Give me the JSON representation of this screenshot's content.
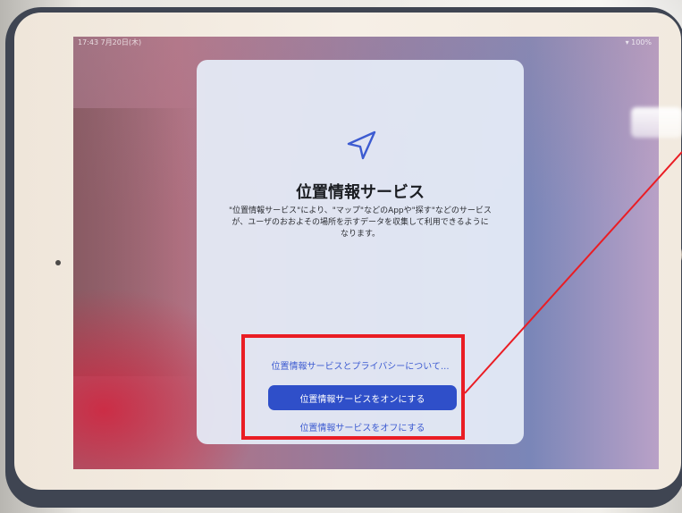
{
  "status_bar": {
    "time_date": "17:43 7月20日(木)",
    "battery": "▾ 100%"
  },
  "location_sheet": {
    "icon": "location-arrow-icon",
    "title": "位置情報サービス",
    "description": "\"位置情報サービス\"により、\"マップ\"などのAppや\"探す\"などのサービスが、ユーザのおおよその場所を示すデータを収集して利用できるようになります。",
    "privacy_link": "位置情報サービスとプライバシーについて...",
    "enable_button": "位置情報サービスをオンにする",
    "disable_button": "位置情報サービスをオフにする"
  },
  "colors": {
    "accent": "#2f4fc9",
    "link": "#3d5bd1",
    "annotation": "#ea1d24"
  }
}
